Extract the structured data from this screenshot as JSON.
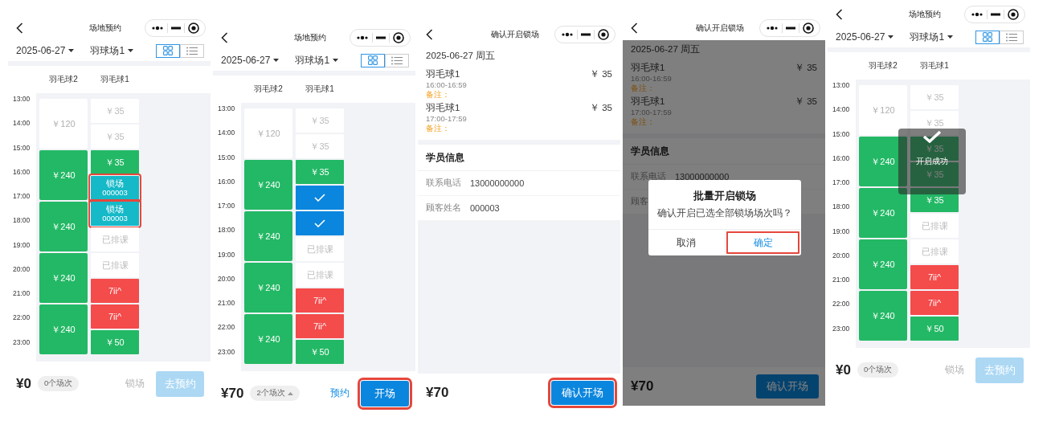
{
  "screens": [
    {
      "kind": "schedule",
      "title": "场地预约",
      "date": "2025-06-27",
      "court": "羽球场1",
      "views": [
        {
          "kind": "grid",
          "selected": true
        },
        {
          "kind": "list",
          "selected": false
        }
      ],
      "times": [
        "13:00",
        "14:00",
        "15:00",
        "16:00",
        "17:00",
        "18:00",
        "19:00",
        "20:00",
        "21:00",
        "22:00",
        "23:00"
      ],
      "columns": [
        {
          "name": "羽毛球2",
          "cells": [
            {
              "kind": "free",
              "text": "￥120",
              "double": true,
              "selected": false,
              "highlighted": false
            },
            {
              "kind": "booked",
              "text": "￥240",
              "double": true,
              "selected": false,
              "highlighted": false
            },
            {
              "kind": "booked",
              "text": "￥240",
              "double": true,
              "selected": false,
              "highlighted": false
            },
            {
              "kind": "booked",
              "text": "￥240",
              "double": true,
              "selected": false,
              "highlighted": false
            },
            {
              "kind": "booked",
              "text": "￥240",
              "double": true,
              "selected": false,
              "highlighted": false
            }
          ]
        },
        {
          "name": "羽毛球1",
          "cells": [
            {
              "kind": "free",
              "text": "￥35",
              "double": false,
              "selected": false,
              "highlighted": false
            },
            {
              "kind": "free",
              "text": "￥35",
              "double": false,
              "selected": false,
              "highlighted": false
            },
            {
              "kind": "booked",
              "text": "￥35",
              "double": false,
              "selected": false,
              "highlighted": false
            },
            {
              "kind": "locked",
              "text": "锁场",
              "customer": "000003",
              "double": false,
              "selected": false,
              "highlighted": true
            },
            {
              "kind": "locked",
              "text": "锁场",
              "customer": "000003",
              "double": false,
              "selected": false,
              "highlighted": true
            },
            {
              "kind": "scheduled",
              "text": "已排课",
              "double": false,
              "selected": false,
              "highlighted": false
            },
            {
              "kind": "scheduled",
              "text": "已排课",
              "double": false,
              "selected": false,
              "highlighted": false
            },
            {
              "kind": "occupied",
              "text": "7ii^",
              "double": false,
              "selected": false,
              "highlighted": false
            },
            {
              "kind": "occupied",
              "text": "7ii^",
              "double": false,
              "selected": false,
              "highlighted": false
            },
            {
              "kind": "booked",
              "text": "￥50",
              "double": false,
              "selected": false,
              "highlighted": false
            }
          ]
        }
      ],
      "footer": {
        "total": "¥0",
        "count": "0个场次",
        "expandable": false,
        "link": {
          "label": "锁场",
          "disabled": true
        },
        "button": {
          "label": "去预约",
          "disabled": true,
          "highlighted": false
        }
      }
    },
    {
      "kind": "schedule",
      "title": "场地预约",
      "date": "2025-06-27",
      "court": "羽球场1",
      "views": [
        {
          "kind": "grid",
          "selected": true
        },
        {
          "kind": "list",
          "selected": false
        }
      ],
      "times": [
        "13:00",
        "14:00",
        "15:00",
        "16:00",
        "17:00",
        "18:00",
        "19:00",
        "20:00",
        "21:00",
        "22:00",
        "23:00"
      ],
      "columns": [
        {
          "name": "羽毛球2",
          "cells": [
            {
              "kind": "free",
              "text": "￥120",
              "double": true,
              "selected": false,
              "highlighted": false
            },
            {
              "kind": "booked",
              "text": "￥240",
              "double": true,
              "selected": false,
              "highlighted": false
            },
            {
              "kind": "booked",
              "text": "￥240",
              "double": true,
              "selected": false,
              "highlighted": false
            },
            {
              "kind": "booked",
              "text": "￥240",
              "double": true,
              "selected": false,
              "highlighted": false
            },
            {
              "kind": "booked",
              "text": "￥240",
              "double": true,
              "selected": false,
              "highlighted": false
            }
          ]
        },
        {
          "name": "羽毛球1",
          "cells": [
            {
              "kind": "free",
              "text": "￥35",
              "double": false,
              "selected": false,
              "highlighted": false
            },
            {
              "kind": "free",
              "text": "￥35",
              "double": false,
              "selected": false,
              "highlighted": false
            },
            {
              "kind": "booked",
              "text": "￥35",
              "double": false,
              "selected": false,
              "highlighted": false
            },
            {
              "kind": "locked",
              "double": false,
              "selected": true,
              "highlighted": false
            },
            {
              "kind": "locked",
              "double": false,
              "selected": true,
              "highlighted": false
            },
            {
              "kind": "scheduled",
              "text": "已排课",
              "double": false,
              "selected": false,
              "highlighted": false
            },
            {
              "kind": "scheduled",
              "text": "已排课",
              "double": false,
              "selected": false,
              "highlighted": false
            },
            {
              "kind": "occupied",
              "text": "7ii^",
              "double": false,
              "selected": false,
              "highlighted": false
            },
            {
              "kind": "occupied",
              "text": "7ii^",
              "double": false,
              "selected": false,
              "highlighted": false
            },
            {
              "kind": "booked",
              "text": "￥50",
              "double": false,
              "selected": false,
              "highlighted": false
            }
          ]
        }
      ],
      "footer": {
        "total": "¥70",
        "count": "2个场次",
        "expandable": true,
        "link": {
          "label": "预约",
          "disabled": false
        },
        "button": {
          "label": "开场",
          "disabled": false,
          "highlighted": true
        }
      }
    },
    {
      "kind": "confirm",
      "title": "确认开启锁场",
      "date": "2025-06-27 周五",
      "items": [
        {
          "court": "羽毛球1",
          "time": "16:00-16:59",
          "note": "备注：",
          "price": "￥ 35"
        },
        {
          "court": "羽毛球1",
          "time": "17:00-17:59",
          "note": "备注：",
          "price": "￥ 35"
        }
      ],
      "section": "学员信息",
      "fields": [
        {
          "label": "联系电话",
          "value": "13000000000"
        },
        {
          "label": "顾客姓名",
          "value": "000003"
        }
      ],
      "footer": {
        "total": "¥70",
        "button": {
          "label": "确认开场",
          "disabled": false,
          "highlighted": true
        }
      }
    },
    {
      "kind": "confirm",
      "title": "确认开启锁场",
      "date": "2025-06-27 周五",
      "items": [
        {
          "court": "羽毛球1",
          "time": "16:00-16:59",
          "note": "备注：",
          "price": "￥ 35"
        },
        {
          "court": "羽毛球1",
          "time": "17:00-17:59",
          "note": "备注：",
          "price": "￥ 35"
        }
      ],
      "section": "学员信息",
      "fields": [
        {
          "label": "联系电话",
          "value": "13000000000"
        },
        {
          "label": "顾客"
        }
      ],
      "footer": {
        "total": "¥70",
        "button": {
          "label": "确认开场",
          "disabled": false,
          "highlighted": false
        }
      },
      "dialog": {
        "title": "批量开启锁场",
        "message": "确认开启已选全部锁场场次吗？",
        "buttons": [
          {
            "label": "取消",
            "primary": false,
            "highlighted": false
          },
          {
            "label": "确定",
            "primary": true,
            "highlighted": true
          }
        ]
      }
    },
    {
      "kind": "schedule",
      "title": "场地预约",
      "date": "2025-06-27",
      "court": "羽球场1",
      "views": [
        {
          "kind": "grid",
          "selected": true
        },
        {
          "kind": "list",
          "selected": false
        }
      ],
      "times": [
        "13:00",
        "14:00",
        "15:00",
        "16:00",
        "17:00",
        "18:00",
        "19:00",
        "20:00",
        "21:00",
        "22:00",
        "23:00"
      ],
      "columns": [
        {
          "name": "羽毛球2",
          "cells": [
            {
              "kind": "free",
              "text": "￥120",
              "double": true,
              "selected": false,
              "highlighted": false
            },
            {
              "kind": "booked",
              "text": "￥240",
              "double": true,
              "selected": false,
              "highlighted": false
            },
            {
              "kind": "booked",
              "text": "￥240",
              "double": true,
              "selected": false,
              "highlighted": false
            },
            {
              "kind": "booked",
              "text": "￥240",
              "double": true,
              "selected": false,
              "highlighted": false
            },
            {
              "kind": "booked",
              "text": "￥240",
              "double": true,
              "selected": false,
              "highlighted": false
            }
          ]
        },
        {
          "name": "羽毛球1",
          "cells": [
            {
              "kind": "free",
              "text": "￥35",
              "double": false,
              "selected": false,
              "highlighted": false
            },
            {
              "kind": "free",
              "text": "￥35",
              "double": false,
              "selected": false,
              "highlighted": false
            },
            {
              "kind": "booked",
              "text": "￥35",
              "double": false,
              "selected": false,
              "highlighted": false
            },
            {
              "kind": "booked",
              "text": "￥35",
              "double": false,
              "selected": false,
              "highlighted": false
            },
            {
              "kind": "booked",
              "text": "￥35",
              "double": false,
              "selected": false,
              "highlighted": false
            },
            {
              "kind": "scheduled",
              "text": "已排课",
              "double": false,
              "selected": false,
              "highlighted": false
            },
            {
              "kind": "scheduled",
              "text": "已排课",
              "double": false,
              "selected": false,
              "highlighted": false
            },
            {
              "kind": "occupied",
              "text": "7ii^",
              "double": false,
              "selected": false,
              "highlighted": false
            },
            {
              "kind": "occupied",
              "text": "7ii^",
              "double": false,
              "selected": false,
              "highlighted": false
            },
            {
              "kind": "booked",
              "text": "￥50",
              "double": false,
              "selected": false,
              "highlighted": false
            }
          ]
        }
      ],
      "toast": {
        "text": "开启成功"
      },
      "footer": {
        "total": "¥0",
        "count": "0个场次",
        "expandable": false,
        "link": {
          "label": "锁场",
          "disabled": true
        },
        "button": {
          "label": "去预约",
          "disabled": true,
          "highlighted": false
        }
      }
    }
  ]
}
